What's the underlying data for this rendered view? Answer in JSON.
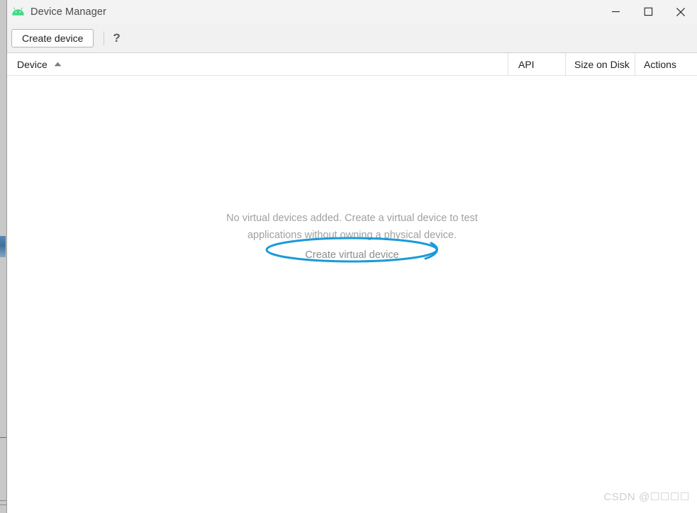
{
  "window": {
    "title": "Device Manager",
    "app_icon": "android-robot-icon",
    "controls": {
      "minimize": "minimize-icon",
      "maximize": "maximize-icon",
      "close": "close-icon"
    }
  },
  "toolbar": {
    "create_device_label": "Create device",
    "help_label": "?"
  },
  "table": {
    "columns": [
      {
        "label": "Device",
        "sort": "ascending"
      },
      {
        "label": "API",
        "sort": "none"
      },
      {
        "label": "Size on Disk",
        "sort": "none"
      },
      {
        "label": "Actions",
        "sort": "none"
      }
    ]
  },
  "empty_state": {
    "line1": "No virtual devices added. Create a virtual device to test",
    "line2": "applications without owning a physical device.",
    "link_label": "Create virtual device"
  },
  "annotation": {
    "shape": "ellipse-highlight",
    "color": "#1b9ad8"
  },
  "watermark": {
    "text": "CSDN @☐☐☐☐"
  },
  "colors": {
    "android_green": "#3ddc84",
    "toolbar_bg": "#f1f1f1",
    "titlebar_bg": "#f3f3f3",
    "content_bg": "#ffffff",
    "muted_text": "#a0a0a0",
    "annotation_blue": "#1b9ad8"
  }
}
